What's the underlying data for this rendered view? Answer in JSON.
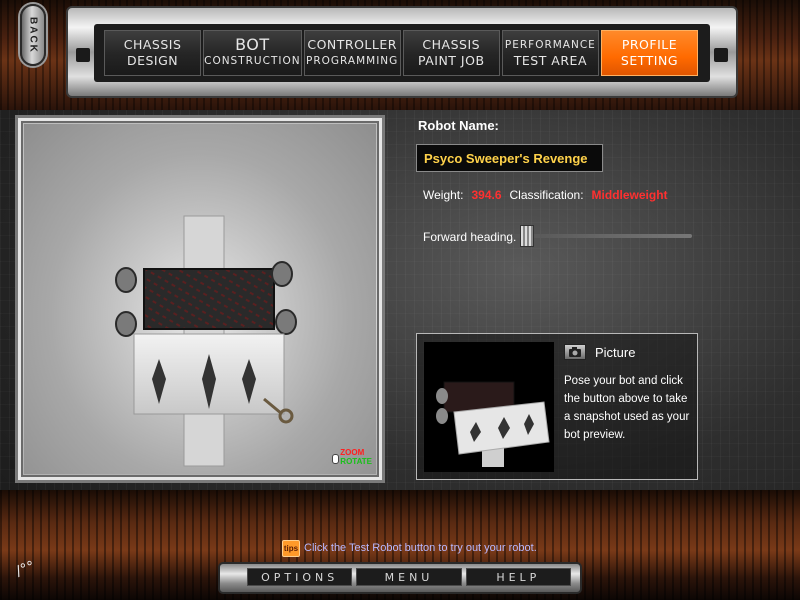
{
  "nav": {
    "back_label": "BACK",
    "tabs": [
      {
        "line1": "CHASSIS",
        "line2": "DESIGN",
        "active": false
      },
      {
        "line1": "BOT",
        "line2": "CONSTRUCTION",
        "active": false
      },
      {
        "line1": "CONTROLLER",
        "line2": "PROGRAMMING",
        "active": false
      },
      {
        "line1": "CHASSIS",
        "line2": "PAINT JOB",
        "active": false
      },
      {
        "line1": "PERFORMANCE",
        "line2": "TEST AREA",
        "active": false
      },
      {
        "line1": "PROFILE",
        "line2": "SETTING",
        "active": true
      }
    ]
  },
  "viewport": {
    "zoom_label": "ZOOM",
    "rotate_label": "ROTATE"
  },
  "profile": {
    "robot_name_label": "Robot Name:",
    "robot_name_value": "Psyco Sweeper's Revenge",
    "weight_label": "Weight:",
    "weight_value": "394.6",
    "classification_label": "Classification:",
    "classification_value": "Middleweight",
    "heading_label": "Forward heading:",
    "heading_level": 0.05
  },
  "picture": {
    "title": "Picture",
    "description": "Pose your bot and click the button above to take a snapshot used as your bot preview."
  },
  "tips": {
    "icon_text": "tips",
    "text": "Click the Test Robot button to try out your robot."
  },
  "menu": {
    "options_label": "OPTIONS",
    "menu_label": "MENU",
    "help_label": "HELP"
  },
  "brand": {
    "mark": "/°°"
  },
  "colors": {
    "accent": "#ff6a00",
    "name_text": "#ffd24a",
    "stat_value": "#ff3030"
  }
}
